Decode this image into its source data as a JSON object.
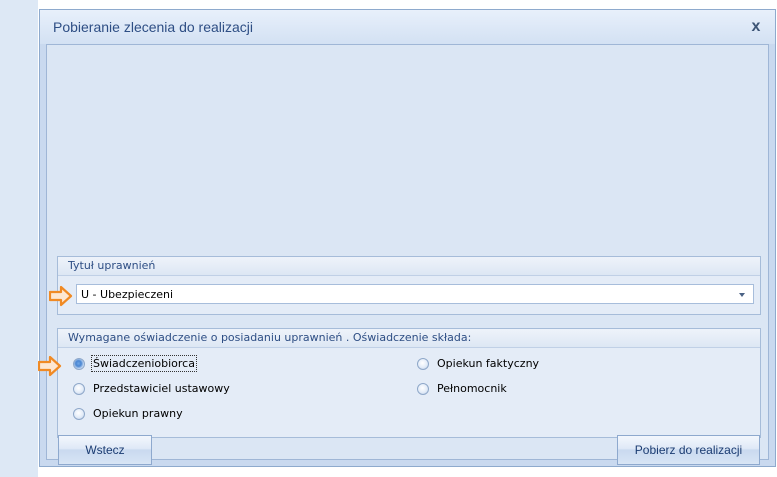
{
  "dialog": {
    "title": "Pobieranie zlecenia do realizacji",
    "close_glyph": "x"
  },
  "entitlement_group": {
    "header": "Tytuł uprawnień",
    "selected_value": "U - Ubezpieczeni"
  },
  "declaration_group": {
    "header": "Wymagane oświadczenie o posiadaniu uprawnień . Oświadczenie składa:",
    "options": [
      {
        "label": "Świadczeniobiorca",
        "checked": true
      },
      {
        "label": "Przedstawiciel ustawowy",
        "checked": false
      },
      {
        "label": "Opiekun prawny",
        "checked": false
      },
      {
        "label": "Opiekun faktyczny",
        "checked": false
      },
      {
        "label": "Pełnomocnik",
        "checked": false
      }
    ]
  },
  "buttons": {
    "back": "Wstecz",
    "fetch": "Pobierz do realizacji"
  },
  "icons": {
    "combo_arrow": "chevron-down-icon",
    "annotation_arrow": "orange-arrow-icon",
    "annotation_color": "#f08a24"
  },
  "colors": {
    "title_text": "#2e4e84",
    "dialog_bg": "#dbe6f4",
    "group_bg": "#e4ecf7",
    "radio_selected": "#4a86d2"
  }
}
